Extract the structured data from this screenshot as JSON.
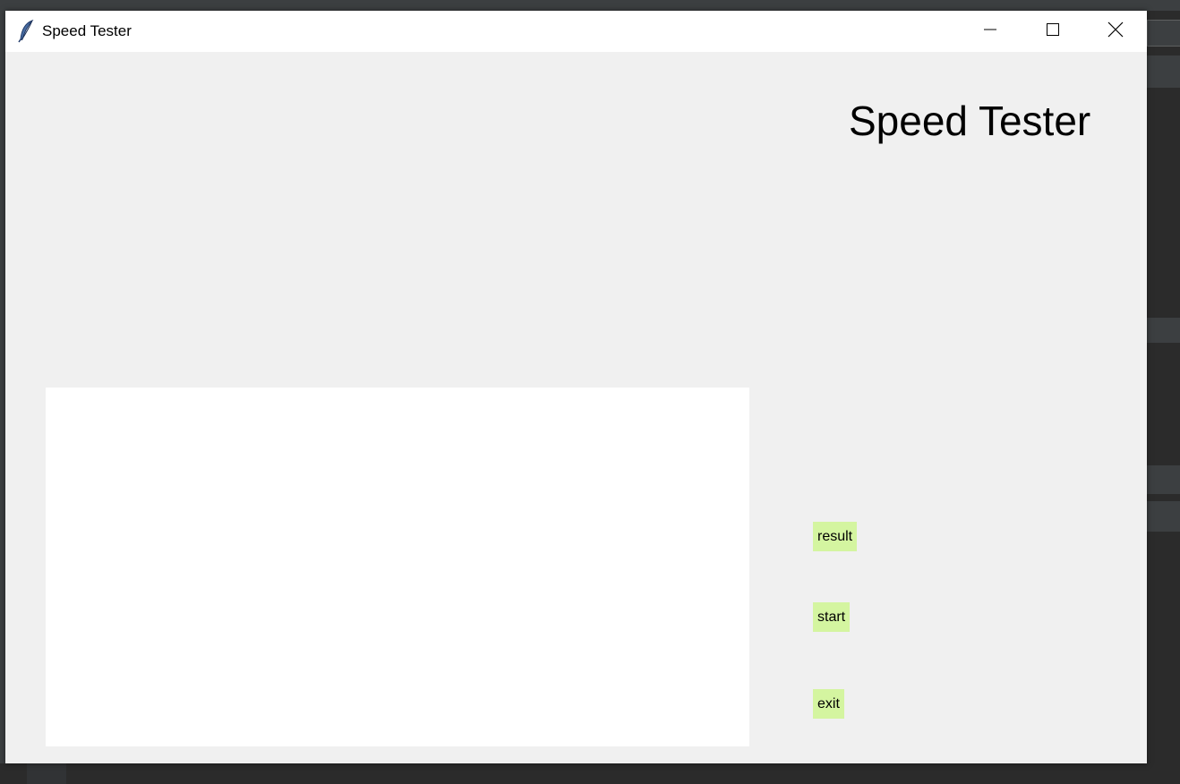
{
  "window": {
    "title": "Speed Tester",
    "icon": "feather-icon",
    "controls": [
      "minimize-icon",
      "maximize-icon",
      "close-icon"
    ]
  },
  "main": {
    "heading": "Speed Tester"
  },
  "buttons": {
    "result": "result",
    "start": "start",
    "exit": "exit"
  },
  "colors": {
    "window_bg": "#f0f0f0",
    "button_bg": "#d4f5a0",
    "canvas_bg": "#ffffff"
  }
}
